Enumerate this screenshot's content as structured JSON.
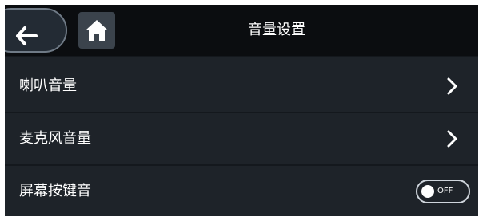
{
  "header": {
    "title": "音量设置",
    "back_icon": "back-arrow-icon",
    "home_icon": "home-icon"
  },
  "items": [
    {
      "label": "喇叭音量",
      "control": "chevron"
    },
    {
      "label": "麦克风音量",
      "control": "chevron"
    },
    {
      "label": "屏幕按键音",
      "control": "toggle",
      "toggle_state": "OFF"
    }
  ],
  "colors": {
    "background": "#1e2329",
    "header": "#0b0d10",
    "text": "#ffffff"
  }
}
